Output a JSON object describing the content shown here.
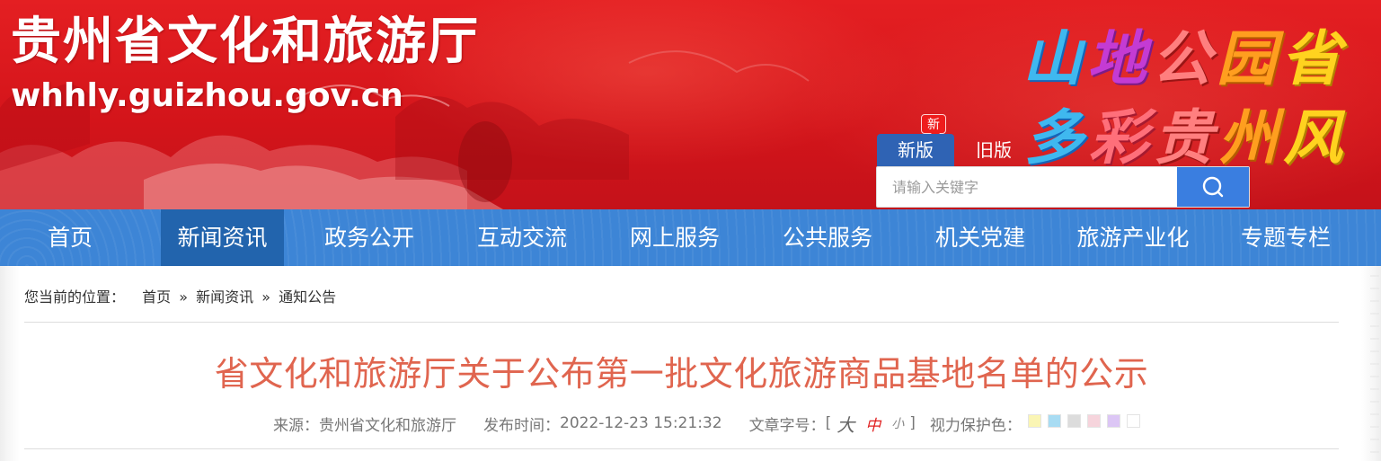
{
  "header": {
    "site_title": "贵州省文化和旅游厅",
    "site_domain": "whhly.guizhou.gov.cn",
    "slogan_line1": [
      "山",
      "地",
      "公",
      "园",
      "省"
    ],
    "slogan_line2": [
      "多",
      "彩",
      "贵",
      "州",
      "风"
    ],
    "new_badge": "新",
    "version_new": "新版",
    "version_old": "旧版",
    "search_placeholder": "请输入关键字"
  },
  "nav": {
    "items": [
      "首页",
      "新闻资讯",
      "政务公开",
      "互动交流",
      "网上服务",
      "公共服务",
      "机关党建",
      "旅游产业化",
      "专题专栏"
    ],
    "active_index": 1
  },
  "breadcrumb": {
    "label": "您当前的位置：",
    "items": [
      "首页",
      "新闻资讯",
      "通知公告"
    ],
    "separator": "»"
  },
  "article": {
    "title": "省文化和旅游厅关于公布第一批文化旅游商品基地名单的公示",
    "source_label": "来源：",
    "source": "贵州省文化和旅游厅",
    "time_label": "发布时间：",
    "time": "2022-12-23 15:21:32",
    "font_size_label": "文章字号：",
    "bracket_open": "[",
    "bracket_close": "]",
    "font_big": "大",
    "font_mid": "中",
    "font_small": "小",
    "eye_care_label": "视力保护色：",
    "eye_care_colors": [
      "#faf5b4",
      "#a8dcf3",
      "#dcdcdc",
      "#f6d4dc",
      "#dcc6f5",
      "#ffffff"
    ]
  },
  "colors": {
    "header_red": "#d3141a",
    "nav_blue": "#3d85d6",
    "nav_active": "#2264ad",
    "title_color": "#e0654f",
    "search_button": "#3a7ee0"
  }
}
